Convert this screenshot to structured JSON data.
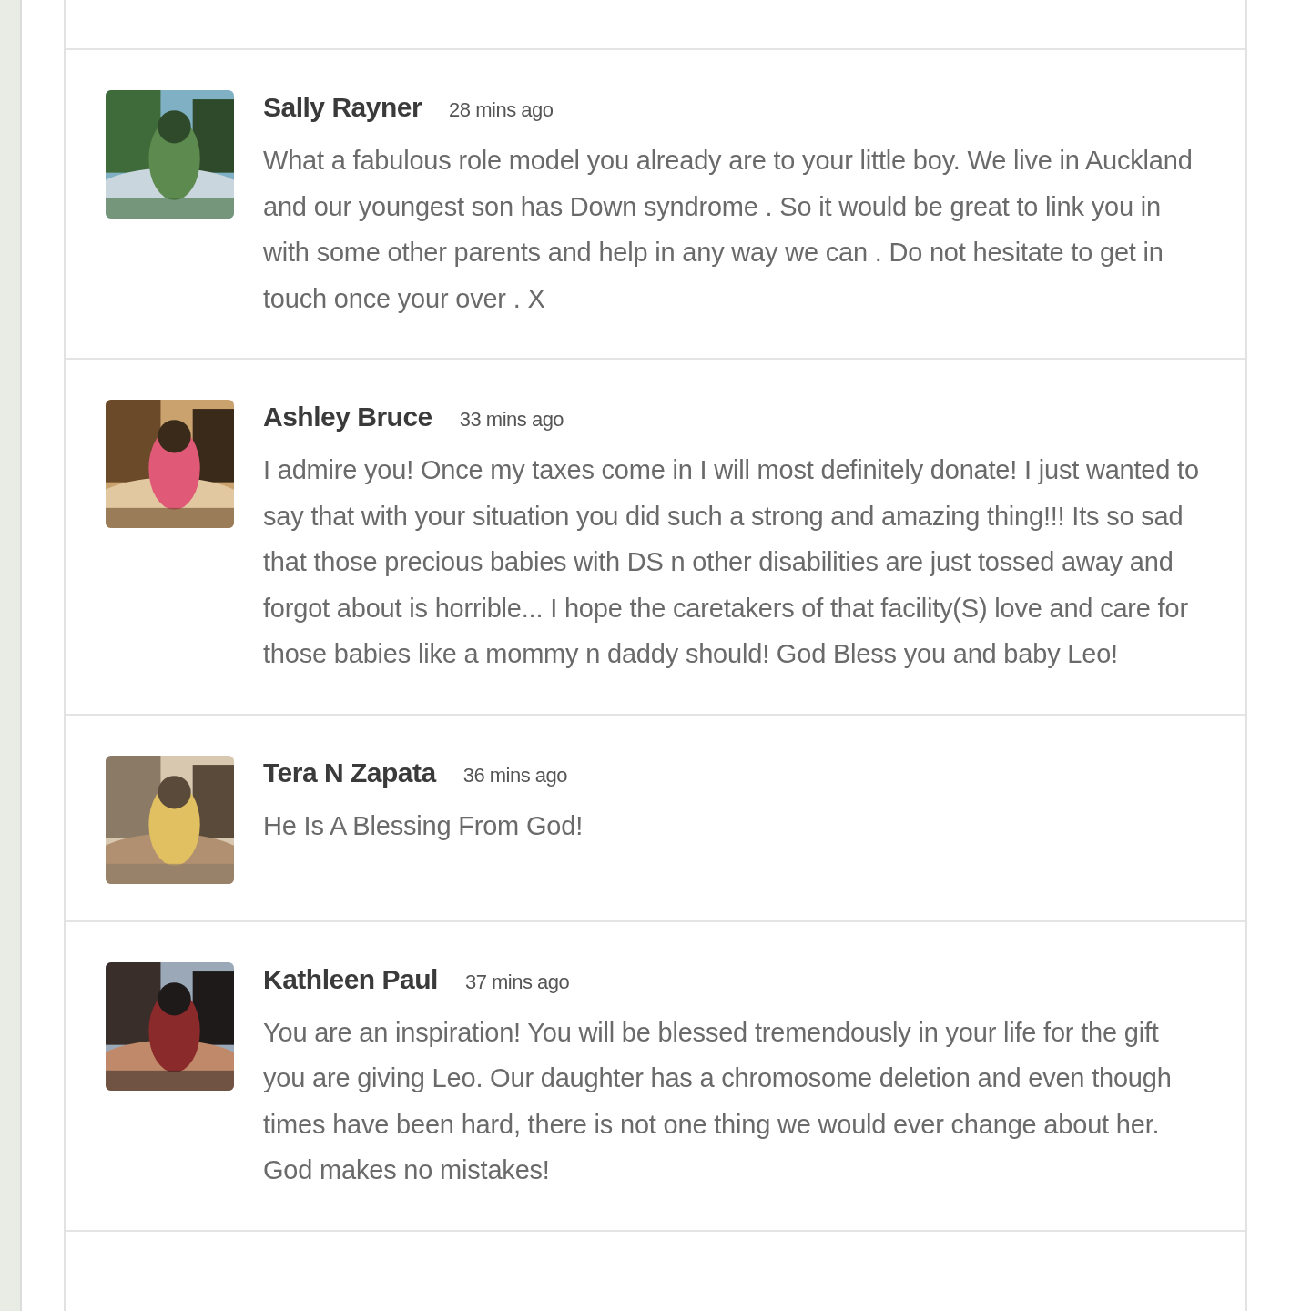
{
  "comments": [
    {
      "author": "Sally Rayner",
      "time": "28 mins ago",
      "text": "What a fabulous role model you already are to your little boy. We live in Auckland and our youngest son has Down syndrome . So it would be great to link you in with some other parents and help in any way we can . Do not hesitate to get in touch once your over . X"
    },
    {
      "author": "Ashley Bruce",
      "time": "33 mins ago",
      "text": "I admire you! Once my taxes come in I will most definitely donate! I just wanted to say that with your situation you did such a strong and amazing thing!!! Its so sad that those precious babies with DS n other disabilities are just tossed away and forgot about is horrible... I hope the caretakers of that facility(S) love and care for those babies like a mommy n daddy should! God Bless you and baby Leo!"
    },
    {
      "author": "Tera N Zapata",
      "time": "36 mins ago",
      "text": "He Is A Blessing From God!"
    },
    {
      "author": "Kathleen Paul",
      "time": "37 mins ago",
      "text": "You are an inspiration! You will be blessed tremendously in your life for the gift you are giving Leo. Our daughter has a chromosome deletion and even though times have been hard, there is not one thing we would ever change about her. God makes no mistakes!"
    }
  ]
}
